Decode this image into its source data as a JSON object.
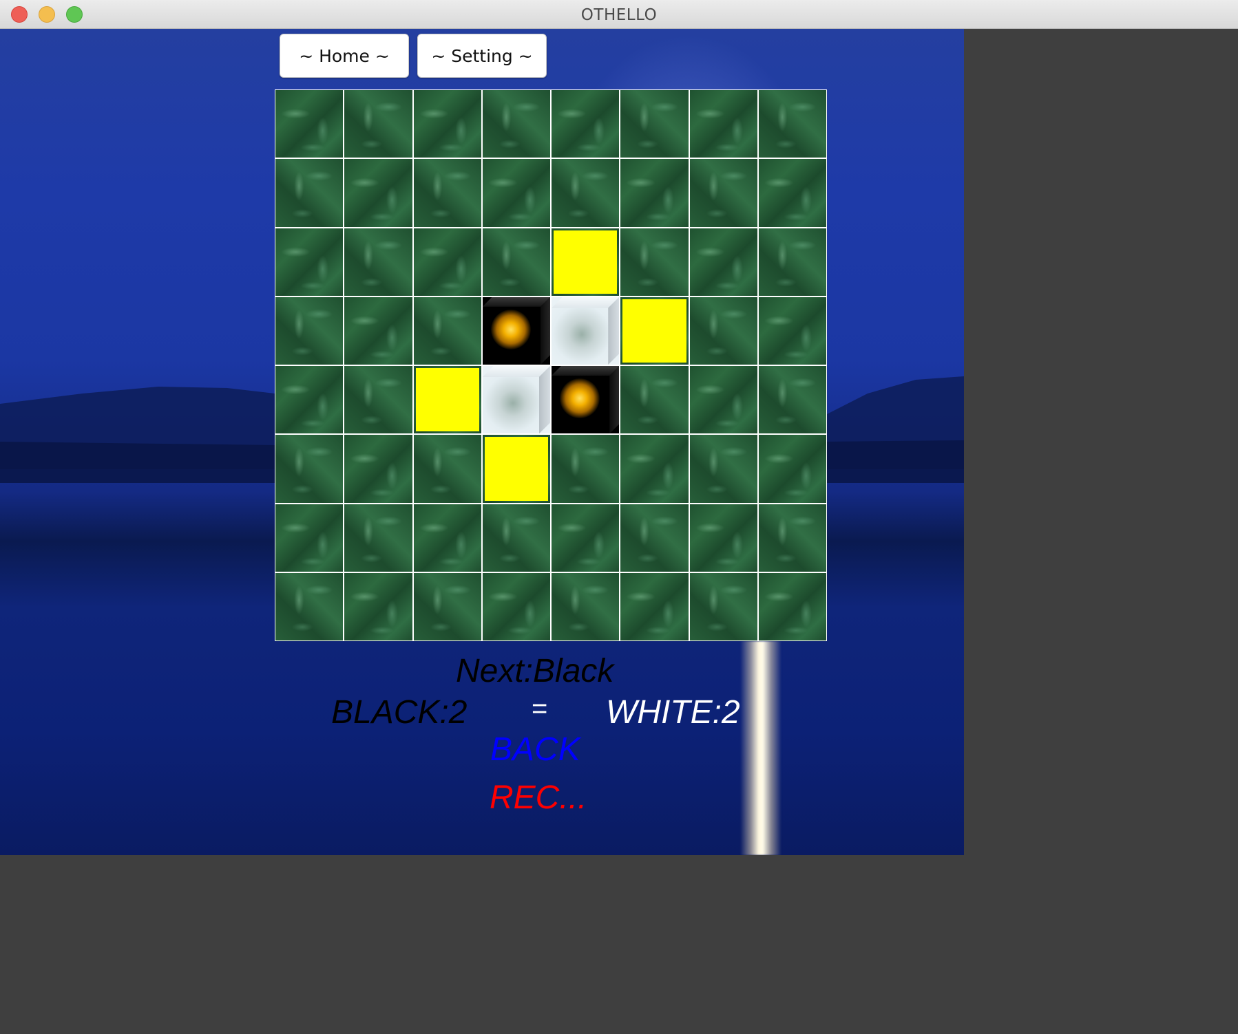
{
  "window": {
    "title": "OTHELLO"
  },
  "nav": {
    "home_label": "~ Home ~",
    "setting_label": "~ Setting ~"
  },
  "board": {
    "size": 8,
    "cells": [
      [
        "",
        "",
        "",
        "",
        "",
        "",
        "",
        ""
      ],
      [
        "",
        "",
        "",
        "",
        "",
        "",
        "",
        ""
      ],
      [
        "",
        "",
        "",
        "",
        "hint",
        "",
        "",
        ""
      ],
      [
        "",
        "",
        "",
        "black",
        "white",
        "hint",
        "",
        ""
      ],
      [
        "",
        "",
        "hint",
        "white",
        "black",
        "",
        "",
        ""
      ],
      [
        "",
        "",
        "",
        "hint",
        "",
        "",
        "",
        ""
      ],
      [
        "",
        "",
        "",
        "",
        "",
        "",
        "",
        ""
      ],
      [
        "",
        "",
        "",
        "",
        "",
        "",
        "",
        ""
      ]
    ],
    "hint_color": "#ffff00"
  },
  "status": {
    "next": "Next:Black",
    "black_score": "BLACK:2",
    "equals": "=",
    "white_score": "WHITE:2"
  },
  "actions": {
    "back_label": "BACK",
    "rec_label": "REC...",
    "back_color": "#0000ff",
    "rec_color": "#ff0000"
  }
}
